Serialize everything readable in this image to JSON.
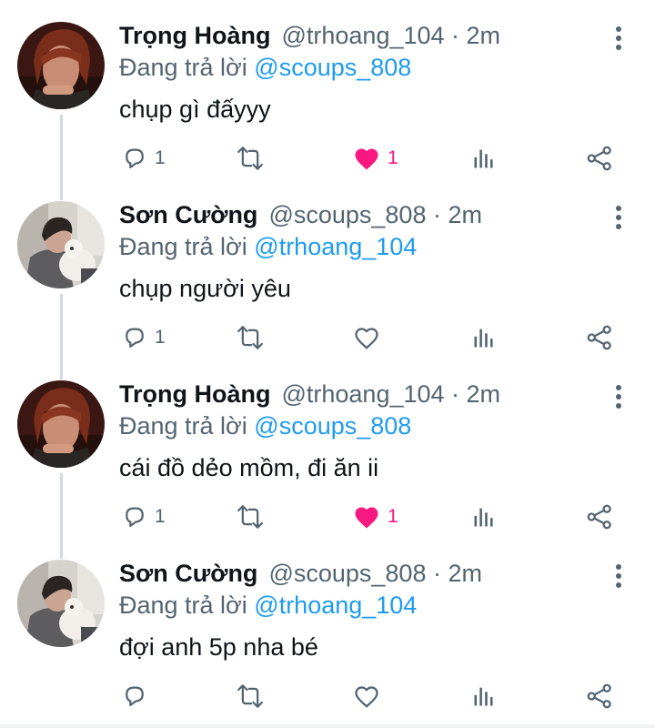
{
  "replying_prefix": "Đang trả lời",
  "colors": {
    "mention": "#1d9bf0",
    "liked_heart": "#f91880",
    "icon_gray": "#536471",
    "text": "#0f1419"
  },
  "tweets": [
    {
      "name": "Trọng Hoàng",
      "handle": "@trhoang_104",
      "time": "· 2m",
      "reply_to": "@scoups_808",
      "text": "chụp gì đấyyy",
      "reply_count": "1",
      "retweet_count": "",
      "like_count": "1",
      "liked": true,
      "avatar": "avatar-trong-hoang"
    },
    {
      "name": "Sơn Cường",
      "handle": "@scoups_808",
      "time": "· 2m",
      "reply_to": "@trhoang_104",
      "text": "chụp người yêu",
      "reply_count": "1",
      "retweet_count": "",
      "like_count": "",
      "liked": false,
      "avatar": "avatar-son-cuong"
    },
    {
      "name": "Trọng Hoàng",
      "handle": "@trhoang_104",
      "time": "· 2m",
      "reply_to": "@scoups_808",
      "text": "cái đồ dẻo mồm, đi ăn ii",
      "reply_count": "1",
      "retweet_count": "",
      "like_count": "1",
      "liked": true,
      "avatar": "avatar-trong-hoang"
    },
    {
      "name": "Sơn Cường",
      "handle": "@scoups_808",
      "time": "· 2m",
      "reply_to": "@trhoang_104",
      "text": "đợi anh 5p nha bé",
      "reply_count": "",
      "retweet_count": "",
      "like_count": "",
      "liked": false,
      "avatar": "avatar-son-cuong"
    }
  ]
}
